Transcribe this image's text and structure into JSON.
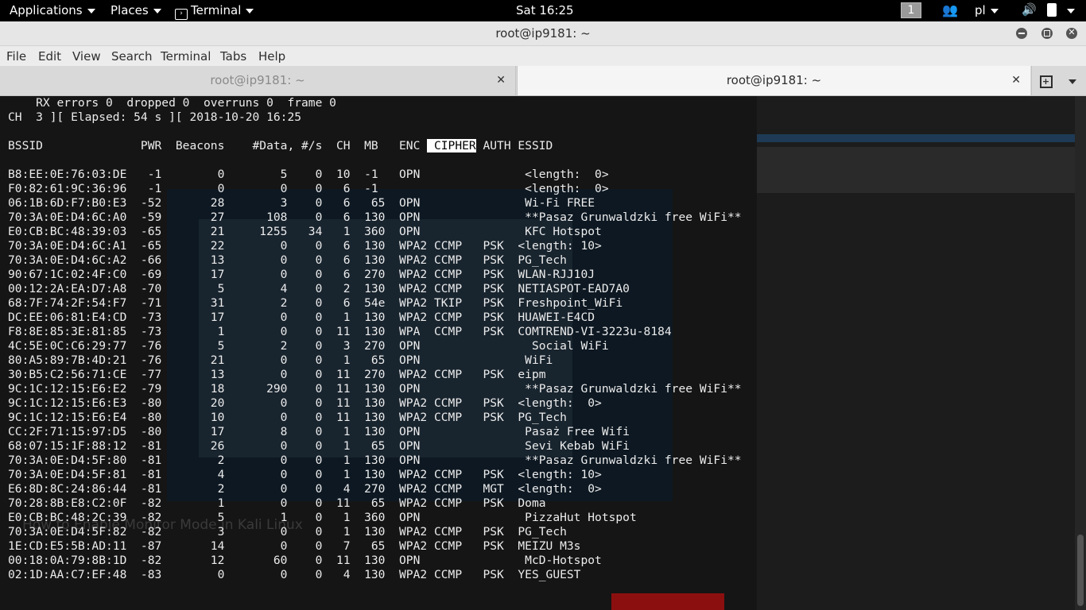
{
  "topbar": {
    "applications": "Applications",
    "places": "Places",
    "terminal": "Terminal",
    "clock": "Sat 16:25",
    "workspace": "1",
    "language": "pl"
  },
  "window": {
    "title": "root@ip9181: ~"
  },
  "menubar": {
    "file": "File",
    "edit": "Edit",
    "view": "View",
    "search": "Search",
    "terminal": "Terminal",
    "tabs": "Tabs",
    "help": "Help"
  },
  "tabs": [
    {
      "label": "root@ip9181: ~"
    },
    {
      "label": "root@ip9181: ~"
    }
  ],
  "background": {
    "video_title": "How to Enable Monitor Mode in Kali Linux"
  },
  "terminal": {
    "line_rx": "    RX errors 0  dropped 0  overruns 0  frame 0",
    "line_ch": "CH  3 ][ Elapsed: 54 s ][ 2018-10-20 16:25",
    "header_pre": "BSSID              PWR  Beacons    #Data, #/s  CH  MB   ENC ",
    "header_hl": " CIPHER",
    "header_post": " AUTH ESSID",
    "rows": [
      "B8:EE:0E:76:03:DE   -1        0        5    0  10  -1   OPN               <length:  0>",
      "F0:82:61:9C:36:96   -1        0        0    0   6  -1                     <length:  0>",
      "06:1B:6D:F7:B0:E3  -52       28        3    0   6   65  OPN               Wi-Fi FREE",
      "70:3A:0E:D4:6C:A0  -59       27      108    0   6  130  OPN               **Pasaz Grunwaldzki free WiFi**",
      "E0:CB:BC:48:39:03  -65       21     1255   34   1  360  OPN               KFC Hotspot",
      "70:3A:0E:D4:6C:A1  -65       22        0    0   6  130  WPA2 CCMP   PSK  <length: 10>",
      "70:3A:0E:D4:6C:A2  -66       13        0    0   6  130  WPA2 CCMP   PSK  PG_Tech",
      "90:67:1C:02:4F:C0  -69       17        0    0   6  270  WPA2 CCMP   PSK  WLAN-RJJ10J",
      "00:12:2A:EA:D7:A8  -70        5        4    0   2  130  WPA2 CCMP   PSK  NETIASPOT-EAD7A0",
      "68:7F:74:2F:54:F7  -71       31        2    0   6  54e  WPA2 TKIP   PSK  Freshpoint_WiFi",
      "DC:EE:06:81:E4:CD  -73       17        0    0   1  130  WPA2 CCMP   PSK  HUAWEI-E4CD",
      "F8:8E:85:3E:81:85  -73        1        0    0  11  130  WPA  CCMP   PSK  COMTREND-VI-3223u-8184",
      "4C:5E:0C:C6:29:77  -76        5        2    0   3  270  OPN                Social WiFi",
      "80:A5:89:7B:4D:21  -76       21        0    0   1   65  OPN               WiFi",
      "30:B5:C2:56:71:CE  -77       13        0    0  11  270  WPA2 CCMP   PSK  eipm",
      "9C:1C:12:15:E6:E2  -79       18      290    0  11  130  OPN               **Pasaz Grunwaldzki free WiFi**",
      "9C:1C:12:15:E6:E3  -80       20        0    0  11  130  WPA2 CCMP   PSK  <length:  0>",
      "9C:1C:12:15:E6:E4  -80       10        0    0  11  130  WPA2 CCMP   PSK  PG_Tech",
      "CC:2F:71:15:97:D5  -80       17        8    0   1  130  OPN               Pasaż Free Wifi",
      "68:07:15:1F:88:12  -81       26        0    0   1   65  OPN               Sevi Kebab WiFi",
      "70:3A:0E:D4:5F:80  -81        2        0    0   1  130  OPN               **Pasaz Grunwaldzki free WiFi**",
      "70:3A:0E:D4:5F:81  -81        4        0    0   1  130  WPA2 CCMP   PSK  <length: 10>",
      "E6:8D:8C:24:86:44  -81        2        0    0   4  270  WPA2 CCMP   MGT  <length:  0>",
      "70:28:8B:E8:C2:0F  -82        1        0    0  11   65  WPA2 CCMP   PSK  Doma",
      "E0:CB:BC:48:2C:39  -82        5        1    0   1  360  OPN               PizzaHut Hotspot",
      "70:3A:0E:D4:5F:82  -82        3        0    0   1  130  WPA2 CCMP   PSK  PG_Tech",
      "1E:CD:E5:5B:AD:11  -87       14        0    0   7   65  WPA2 CCMP   PSK  MEIZU M3s",
      "00:18:0A:79:8B:1D  -82       12       60    0  11  130  OPN               McD-Hotspot",
      "02:1D:AA:C7:EF:48  -83        0        0    0   4  130  WPA2 CCMP   PSK  YES_GUEST"
    ]
  }
}
